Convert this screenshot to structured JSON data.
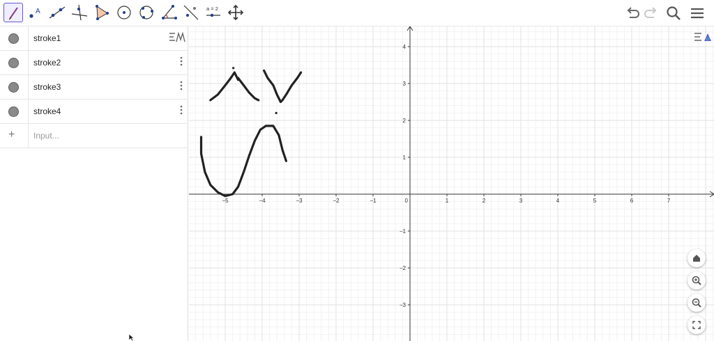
{
  "algebra": {
    "items": [
      {
        "label": "stroke1"
      },
      {
        "label": "stroke2"
      },
      {
        "label": "stroke3"
      },
      {
        "label": "stroke4"
      }
    ],
    "input_placeholder": "Input..."
  },
  "toolbar": {
    "tools": [
      "freehand-tool",
      "point-tool",
      "line-tool",
      "perpendicular-tool",
      "polygon-tool",
      "circle-tool",
      "circle-three-points-tool",
      "angle-tool",
      "reflect-tool",
      "slider-tool",
      "move-view-tool"
    ],
    "slider_label": "a = 2",
    "right": [
      "undo",
      "redo",
      "search",
      "menu"
    ]
  },
  "graphics": {
    "x_ticks": [
      "−5",
      "−4",
      "−3",
      "−2",
      "−1",
      "0",
      "1",
      "2",
      "3",
      "4",
      "5",
      "6",
      "7"
    ],
    "y_ticks": [
      "4",
      "3",
      "2",
      "1",
      "−1",
      "−2",
      "−3"
    ],
    "x_range": [
      -6.2,
      8.0
    ],
    "y_range": [
      -3.8,
      4.8
    ],
    "grid": true,
    "strokes": [
      {
        "name": "stroke1",
        "points": [
          [
            -5.4,
            2.55
          ],
          [
            -5.2,
            2.7
          ],
          [
            -5.0,
            2.95
          ],
          [
            -4.85,
            3.15
          ],
          [
            -4.75,
            3.3
          ],
          [
            -4.65,
            3.1
          ]
        ]
      },
      {
        "name": "stroke2",
        "points": [
          [
            -4.65,
            3.15
          ],
          [
            -4.5,
            2.95
          ],
          [
            -4.35,
            2.75
          ],
          [
            -4.2,
            2.6
          ],
          [
            -4.1,
            2.55
          ]
        ]
      },
      {
        "name": "stroke3",
        "points": [
          [
            -3.95,
            3.35
          ],
          [
            -3.85,
            3.15
          ],
          [
            -3.7,
            2.95
          ],
          [
            -3.6,
            2.7
          ],
          [
            -3.5,
            2.5
          ],
          [
            -3.45,
            2.55
          ],
          [
            -3.35,
            2.7
          ],
          [
            -3.2,
            2.95
          ],
          [
            -3.05,
            3.15
          ],
          [
            -2.95,
            3.3
          ]
        ]
      },
      {
        "name": "stroke4",
        "points": [
          [
            -5.65,
            1.55
          ],
          [
            -5.65,
            1.1
          ],
          [
            -5.55,
            0.6
          ],
          [
            -5.4,
            0.25
          ],
          [
            -5.2,
            0.05
          ],
          [
            -5.0,
            -0.05
          ],
          [
            -4.8,
            0.0
          ],
          [
            -4.65,
            0.2
          ],
          [
            -4.5,
            0.6
          ],
          [
            -4.35,
            1.05
          ],
          [
            -4.2,
            1.45
          ],
          [
            -4.05,
            1.75
          ],
          [
            -3.9,
            1.85
          ],
          [
            -3.7,
            1.85
          ],
          [
            -3.55,
            1.6
          ],
          [
            -3.45,
            1.2
          ],
          [
            -3.35,
            0.9
          ]
        ]
      }
    ],
    "dots": [
      [
        -4.78,
        3.42
      ],
      [
        -3.62,
        2.2
      ]
    ],
    "stroke_color": "#222222",
    "grid_major_color": "#e2e2e2",
    "grid_minor_color": "#f2f2f2",
    "axis_color": "#333333"
  },
  "view_controls": [
    "home-view",
    "zoom-in",
    "zoom-out",
    "fullscreen"
  ],
  "colors": {
    "accent": "#6557d2",
    "panel_border": "#dcdcdc"
  }
}
